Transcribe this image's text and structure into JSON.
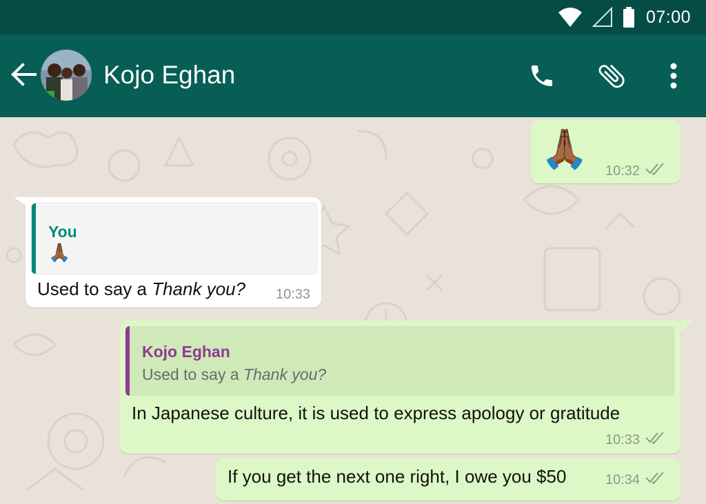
{
  "status_bar": {
    "time": "07:00"
  },
  "header": {
    "contact_name": "Kojo Eghan"
  },
  "icons": {
    "back": "arrow-left-icon",
    "call": "phone-icon",
    "attach": "paperclip-icon",
    "menu": "more-vert-icon"
  },
  "colors": {
    "header": "#075e54",
    "status_bar": "#054d44",
    "outgoing_bubble": "#dcf8c6",
    "incoming_bubble": "#ffffff",
    "quote_you_accent": "#00897b",
    "quote_contact_accent": "#8e3b92",
    "read_ticks": "#8c9a8a"
  },
  "messages": [
    {
      "direction": "outgoing",
      "emoji": "🙏🏾",
      "time": "10:32",
      "status": "read"
    },
    {
      "direction": "incoming",
      "quote": {
        "author": "You",
        "emoji": "🙏🏾"
      },
      "text_before": "Used to say a ",
      "text_italic": "Thank you?",
      "time": "10:33"
    },
    {
      "direction": "outgoing",
      "quote": {
        "author": "Kojo Eghan",
        "text_before": "Used to say a ",
        "text_italic": "Thank you?"
      },
      "text": "In Japanese culture, it is used to express apology or gratitude",
      "time": "10:33",
      "status": "read"
    },
    {
      "direction": "outgoing",
      "text": "If you get the next one right, I owe you $50",
      "time": "10:34",
      "status": "read"
    }
  ]
}
